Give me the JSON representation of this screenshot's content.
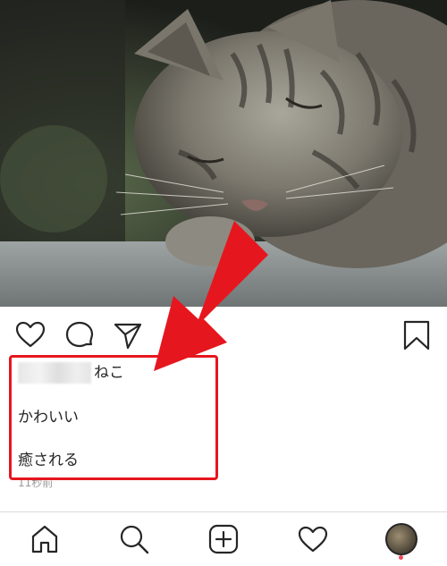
{
  "post": {
    "image_subject": "cat",
    "caption": "ねこ",
    "comments": [
      "かわいい",
      "癒される"
    ],
    "timestamp": "11秒前"
  },
  "actions": {
    "icons": [
      "heart-icon",
      "comment-icon",
      "share-icon",
      "bookmark-icon"
    ]
  },
  "bottom_nav": {
    "icons": [
      "home-icon",
      "search-icon",
      "add-post-icon",
      "activity-heart-icon",
      "profile-avatar"
    ]
  },
  "annotation": {
    "highlight_color": "#e6161e",
    "arrow_color": "#e6161e"
  }
}
